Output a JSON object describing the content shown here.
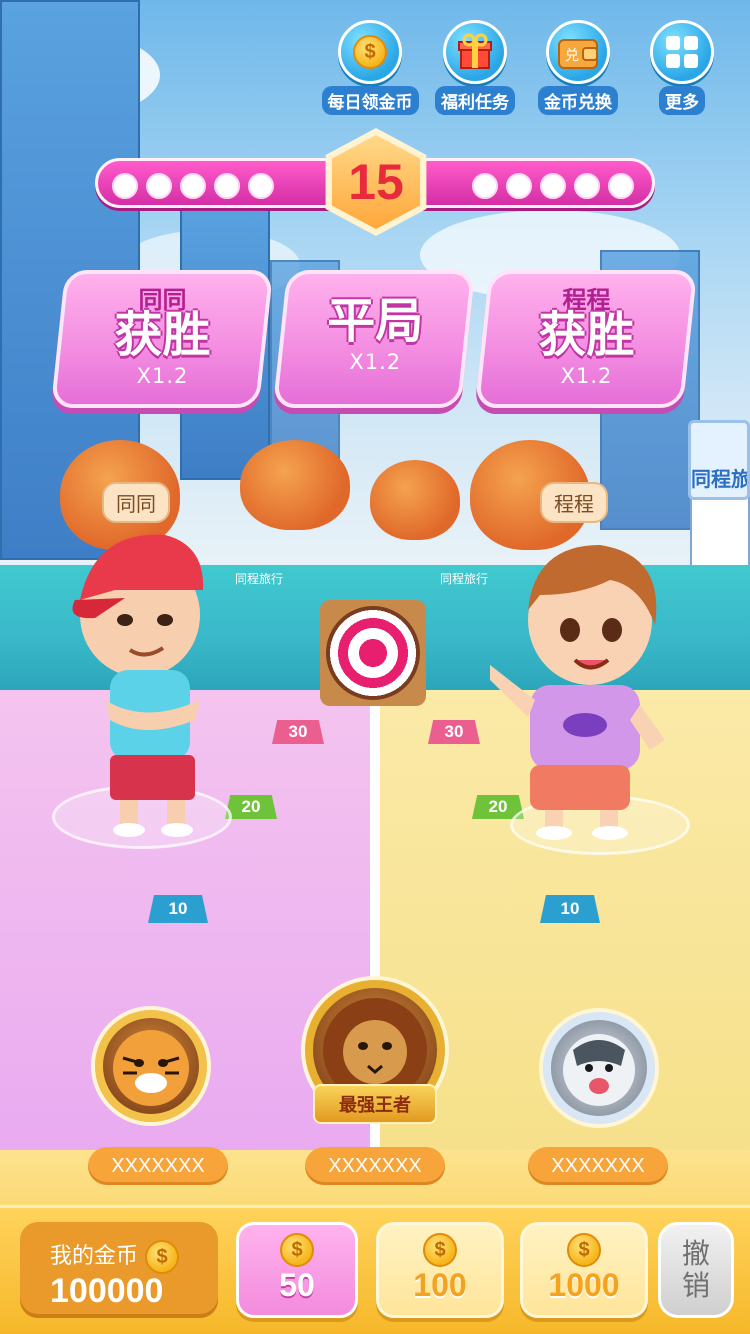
{
  "top_menu": [
    {
      "label": "每日领金币",
      "icon": "coin-icon"
    },
    {
      "label": "福利任务",
      "icon": "gift-icon"
    },
    {
      "label": "金币兑换",
      "icon": "wallet-icon"
    },
    {
      "label": "更多",
      "icon": "grid-icon"
    }
  ],
  "round": {
    "number": "15",
    "left_dots": 5,
    "right_dots": 5
  },
  "bets": [
    {
      "name": "同同",
      "result": "获胜",
      "multiplier": "X1.2"
    },
    {
      "name": "",
      "result": "平局",
      "multiplier": "X1.2"
    },
    {
      "name": "程程",
      "result": "获胜",
      "multiplier": "X1.2"
    }
  ],
  "players": {
    "left": "同同",
    "right": "程程"
  },
  "wall_logo": "同程旅行",
  "billboard": "同程旅",
  "markers": [
    "30",
    "20",
    "10"
  ],
  "leaderboard": {
    "king_label": "最强王者",
    "names": [
      "XXXXXXX",
      "XXXXXXX",
      "XXXXXXX"
    ]
  },
  "wallet": {
    "label": "我的金币",
    "value": "100000",
    "coin_symbol": "$"
  },
  "chips": [
    {
      "value": "50",
      "selected": true
    },
    {
      "value": "100",
      "selected": false
    },
    {
      "value": "1000",
      "selected": false
    }
  ],
  "undo_label": [
    "撤",
    "销"
  ],
  "colors": {
    "pink": "#f48fe2",
    "yellow": "#f6c53e",
    "blue": "#2aa6e6",
    "red_number": "#e72a3c"
  }
}
